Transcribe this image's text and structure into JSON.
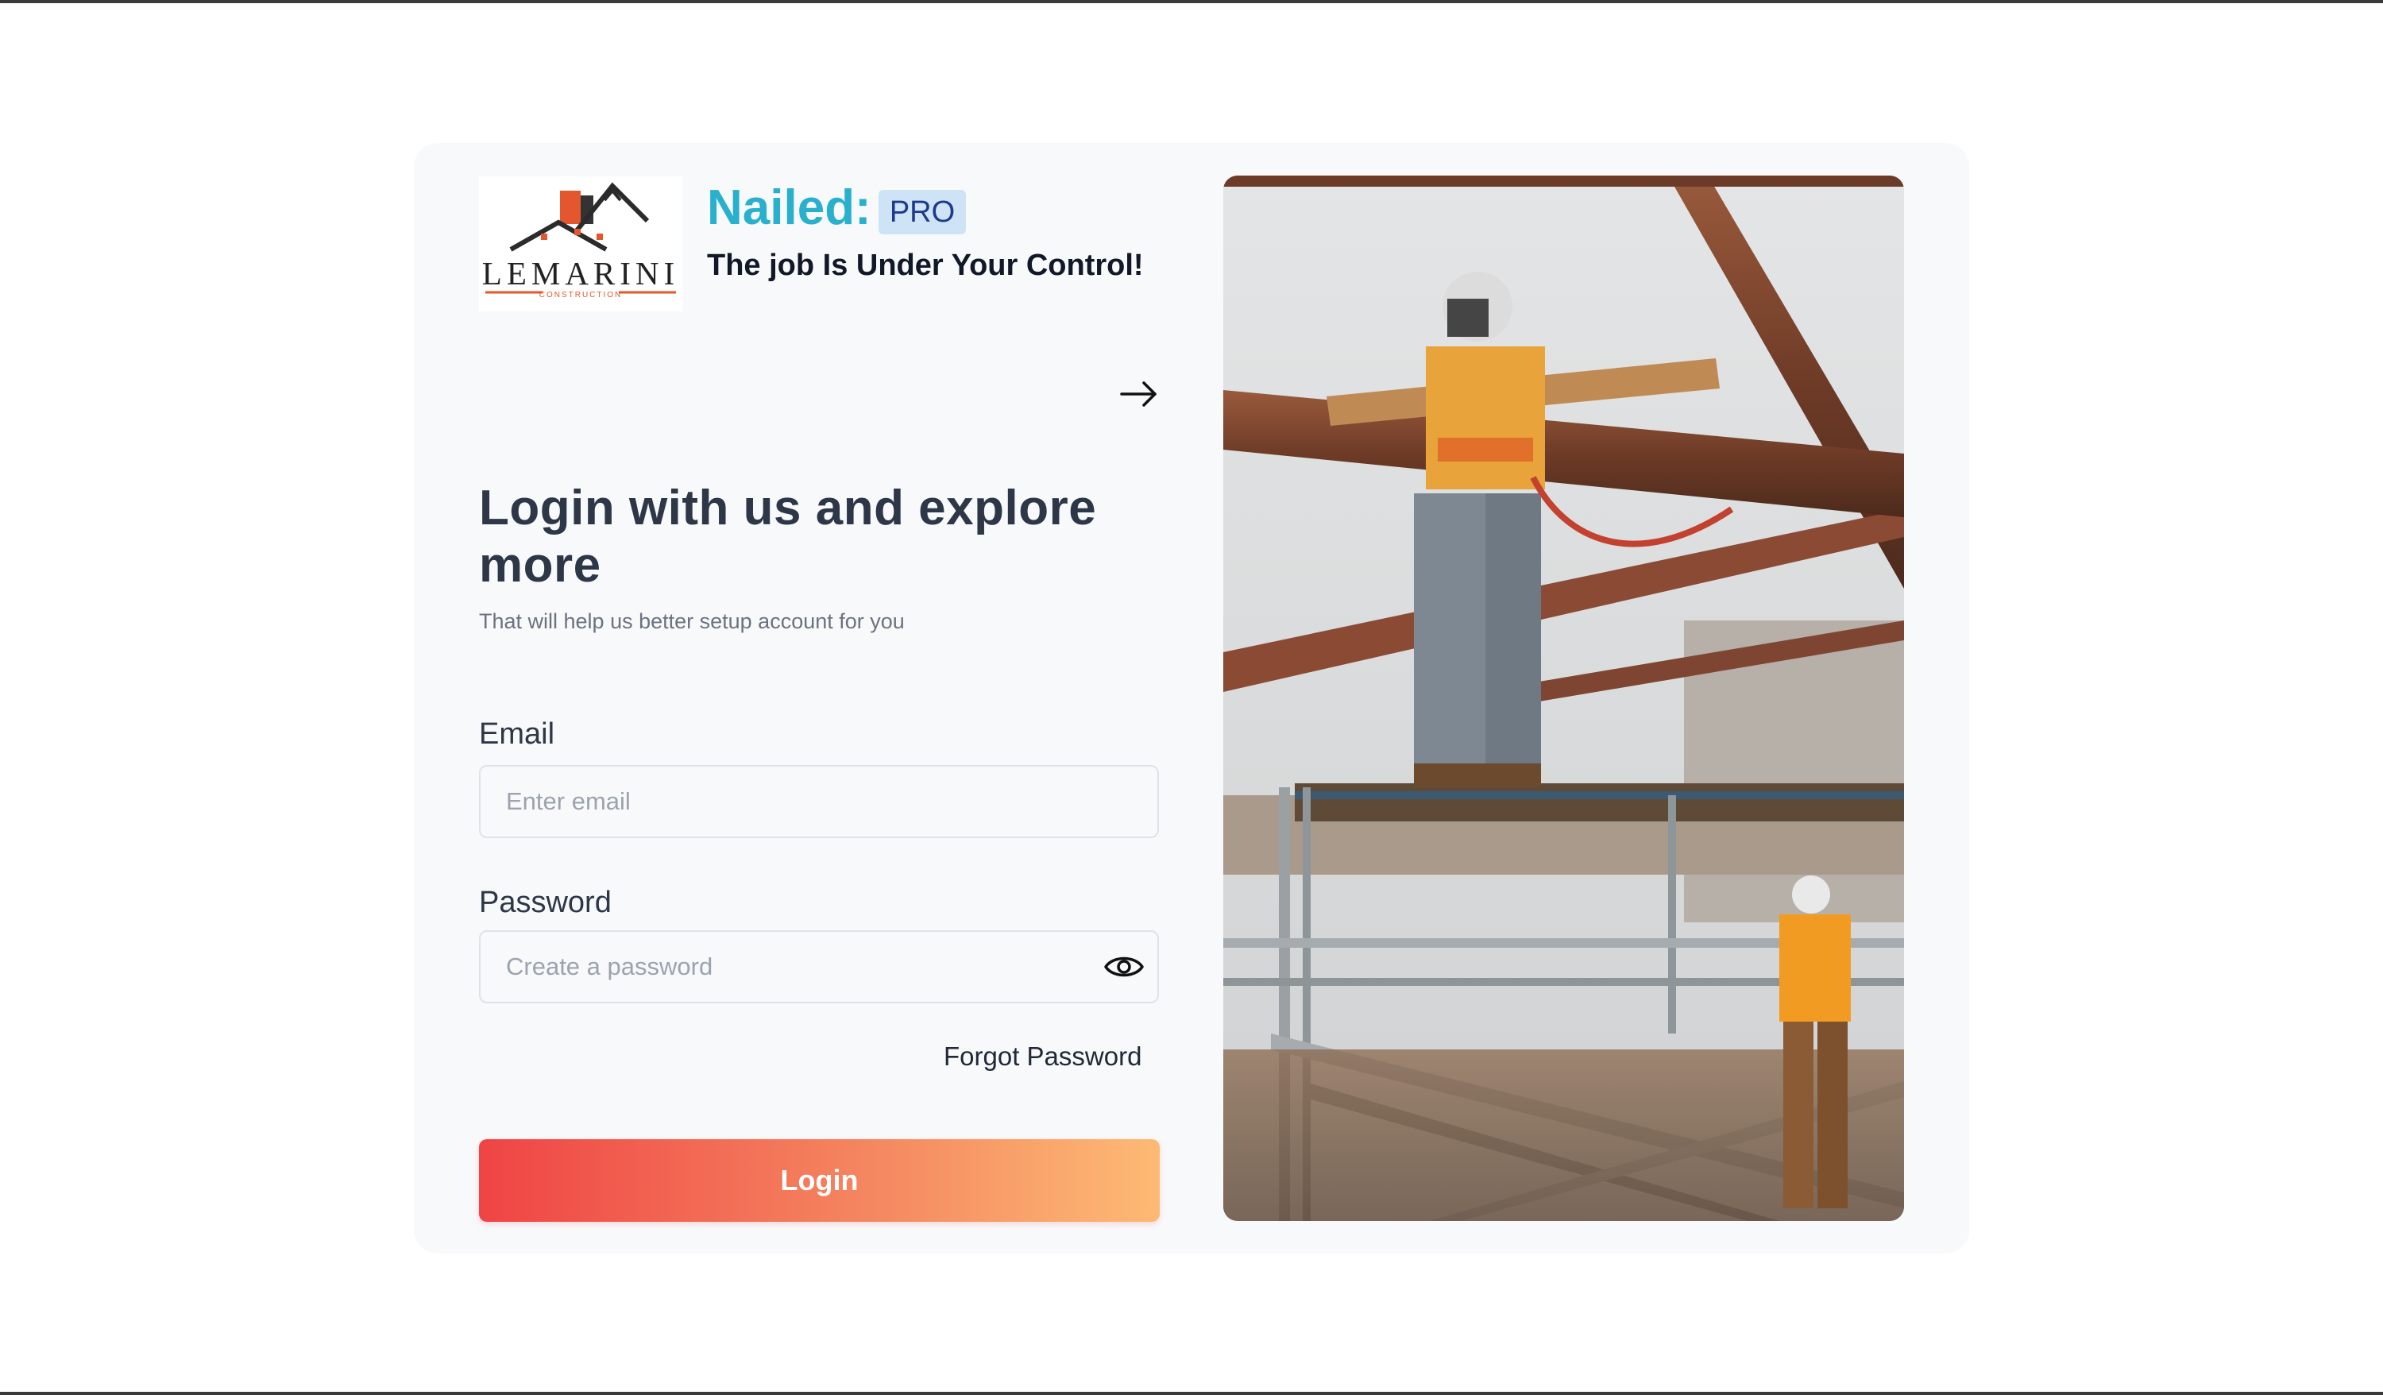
{
  "brand": {
    "logo_text": "LEMARINI",
    "logo_subtext": "CONSTRUCTION",
    "name": "Nailed:",
    "badge": "PRO",
    "tagline": "The job Is Under Your Control!"
  },
  "icons": {
    "continue": "arrow-right-icon",
    "toggle_password": "eye-icon"
  },
  "login": {
    "heading": "Login with us and explore more",
    "subheading": "That will help us better setup account for you"
  },
  "form": {
    "email_label": "Email",
    "email_placeholder": "Enter email",
    "email_value": "",
    "password_label": "Password",
    "password_placeholder": "Create a password",
    "password_value": "",
    "forgot_label": "Forgot Password",
    "submit_label": "Login"
  },
  "colors": {
    "brand_accent": "#29b0cc",
    "badge_bg": "#cfe3f7",
    "badge_text": "#1e3a8a",
    "button_gradient_start": "#ef4444",
    "button_gradient_end": "#fdba74",
    "card_bg": "#f8f9fb"
  },
  "photo": {
    "subject": "construction-workers-on-steel-frame"
  }
}
